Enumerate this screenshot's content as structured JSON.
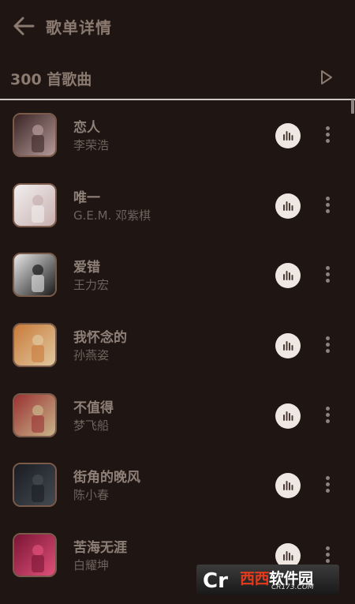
{
  "header": {
    "title": "歌单详情",
    "back_icon": "arrow-left-icon"
  },
  "playlist": {
    "count_label": "300 首歌曲",
    "play_icon": "play-triangle-icon"
  },
  "songs": [
    {
      "name": "恋人",
      "artist": "李荣浩",
      "cover_colors": [
        "#3a2424",
        "#b59a98"
      ]
    },
    {
      "name": "唯一",
      "artist": "G.E.M. 邓紫棋",
      "cover_colors": [
        "#f2efef",
        "#c8b0b0"
      ]
    },
    {
      "name": "爱错",
      "artist": "王力宏",
      "cover_colors": [
        "#e8e8e8",
        "#1a1a1a"
      ]
    },
    {
      "name": "我怀念的",
      "artist": "孙燕姿",
      "cover_colors": [
        "#c97a3a",
        "#e0c9a0"
      ]
    },
    {
      "name": "不值得",
      "artist": "梦飞船",
      "cover_colors": [
        "#9a3232",
        "#c9b58a"
      ]
    },
    {
      "name": "街角的晚风",
      "artist": "陈小春",
      "cover_colors": [
        "#1a1d22",
        "#444a52"
      ]
    },
    {
      "name": "苦海无涯",
      "artist": "白耀坤",
      "cover_colors": [
        "#7a1535",
        "#e0507a"
      ]
    }
  ],
  "icons": {
    "equalizer": "equalizer-icon",
    "more": "more-vertical-icon"
  },
  "colors": {
    "background": "#1f1512",
    "accent_button": "#efe7e2"
  },
  "watermark": {
    "logo": "Cr",
    "text_red": "西西",
    "text_white": "软件园",
    "sub": "CR173.COM"
  }
}
